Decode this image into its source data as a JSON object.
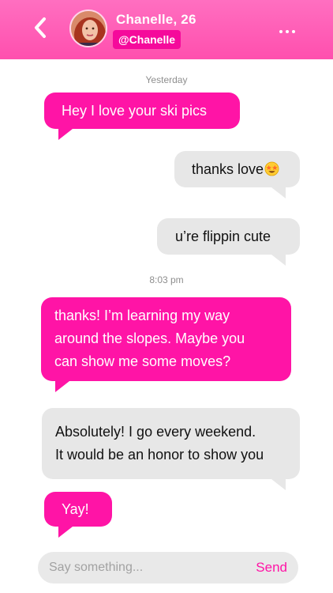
{
  "header": {
    "contact_name": "Chanelle, 26",
    "contact_handle": "@Chanelle",
    "back_icon": "chevron-left-icon",
    "more_icon": "ellipsis-icon",
    "colors": {
      "bar": "#ff5cb6",
      "handle_bg": "#f50a9b"
    }
  },
  "thread": {
    "stamps": [
      "Yesterday",
      "8:03 pm"
    ],
    "messages": [
      {
        "from": "them",
        "text": "Hey I love your ski pics"
      },
      {
        "from": "me",
        "text": "thanks love",
        "emoji": "star-struck-emoji"
      },
      {
        "from": "me",
        "text": "u’re flippin cute"
      },
      {
        "from": "them",
        "lines": [
          "thanks!  I’m learning my way",
          "around the slopes. Maybe you",
          "can show me some moves?"
        ]
      },
      {
        "from": "me",
        "lines": [
          "Absolutely! I go every weekend.",
          "It would be an honor to show you"
        ]
      },
      {
        "from": "them",
        "text": "Yay!"
      }
    ]
  },
  "composer": {
    "placeholder": "Say something...",
    "send_label": "Send"
  },
  "colors": {
    "accent": "#ff14a6",
    "bubble_gray": "#e7e7e7"
  }
}
